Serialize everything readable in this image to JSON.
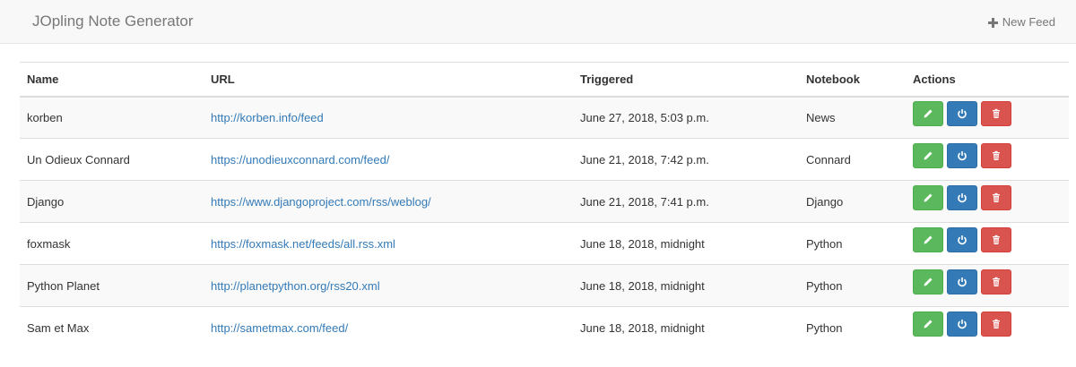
{
  "app": {
    "title": "JOpling Note Generator",
    "new_feed_label": "New Feed"
  },
  "colors": {
    "edit": "#5cb85c",
    "toggle": "#337ab7",
    "delete": "#d9534f",
    "link": "#337ab7"
  },
  "table": {
    "headers": {
      "name": "Name",
      "url": "URL",
      "triggered": "Triggered",
      "notebook": "Notebook",
      "actions": "Actions"
    },
    "rows": [
      {
        "name": "korben",
        "url": "http://korben.info/feed",
        "triggered": "June 27, 2018, 5:03 p.m.",
        "notebook": "News"
      },
      {
        "name": "Un Odieux Connard",
        "url": "https://unodieuxconnard.com/feed/",
        "triggered": "June 21, 2018, 7:42 p.m.",
        "notebook": "Connard"
      },
      {
        "name": "Django",
        "url": "https://www.djangoproject.com/rss/weblog/",
        "triggered": "June 21, 2018, 7:41 p.m.",
        "notebook": "Django"
      },
      {
        "name": "foxmask",
        "url": "https://foxmask.net/feeds/all.rss.xml",
        "triggered": "June 18, 2018, midnight",
        "notebook": "Python"
      },
      {
        "name": "Python Planet",
        "url": "http://planetpython.org/rss20.xml",
        "triggered": "June 18, 2018, midnight",
        "notebook": "Python"
      },
      {
        "name": "Sam et Max",
        "url": "http://sametmax.com/feed/",
        "triggered": "June 18, 2018, midnight",
        "notebook": "Python"
      }
    ],
    "action_icons": [
      "pencil-icon",
      "power-icon",
      "trash-icon"
    ]
  }
}
